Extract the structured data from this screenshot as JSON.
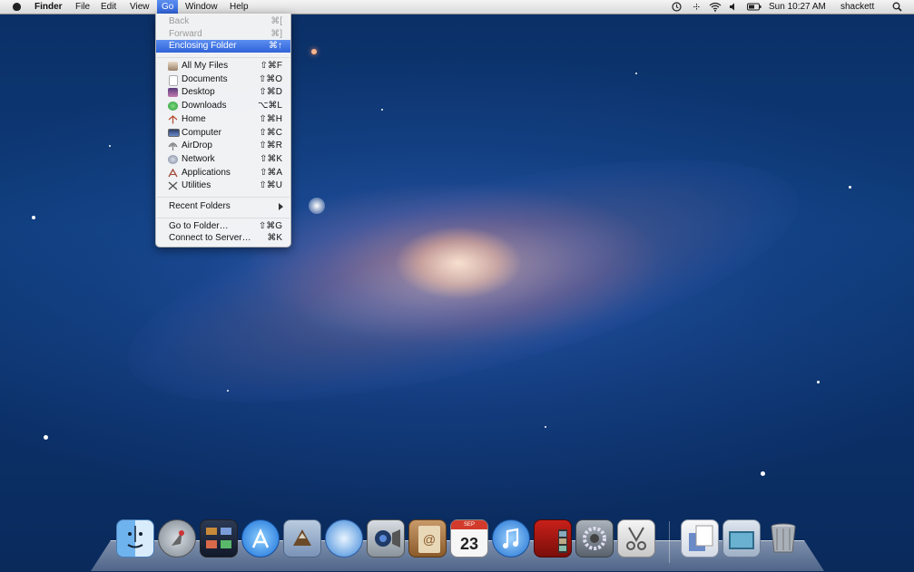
{
  "menubar": {
    "app_name": "Finder",
    "menus": [
      "File",
      "Edit",
      "View",
      "Go",
      "Window",
      "Help"
    ],
    "clock": "Sun 10:27 AM",
    "user": "shackett",
    "status_icons": [
      "time-machine-icon",
      "bluetooth-icon",
      "wifi-icon",
      "volume-icon",
      "battery-icon",
      "spotlight-icon"
    ]
  },
  "go_menu": {
    "items": [
      {
        "label": "Back",
        "shortcut": "⌘[",
        "state": "disabled"
      },
      {
        "label": "Forward",
        "shortcut": "⌘]",
        "state": "disabled"
      },
      {
        "label": "Enclosing Folder",
        "shortcut": "⌘↑",
        "state": "selected"
      },
      {
        "label": "All My Files",
        "shortcut": "⇧⌘F",
        "icon": "all-my-files-icon"
      },
      {
        "label": "Documents",
        "shortcut": "⇧⌘O",
        "icon": "documents-icon"
      },
      {
        "label": "Desktop",
        "shortcut": "⇧⌘D",
        "icon": "desktop-icon"
      },
      {
        "label": "Downloads",
        "shortcut": "⌥⌘L",
        "icon": "downloads-icon"
      },
      {
        "label": "Home",
        "shortcut": "⇧⌘H",
        "icon": "home-icon"
      },
      {
        "label": "Computer",
        "shortcut": "⇧⌘C",
        "icon": "computer-icon"
      },
      {
        "label": "AirDrop",
        "shortcut": "⇧⌘R",
        "icon": "airdrop-icon"
      },
      {
        "label": "Network",
        "shortcut": "⇧⌘K",
        "icon": "network-icon"
      },
      {
        "label": "Applications",
        "shortcut": "⇧⌘A",
        "icon": "applications-icon"
      },
      {
        "label": "Utilities",
        "shortcut": "⇧⌘U",
        "icon": "utilities-icon"
      },
      {
        "label": "Recent Folders",
        "shortcut": "",
        "submenu": true
      },
      {
        "label": "Go to Folder…",
        "shortcut": "⇧⌘G"
      },
      {
        "label": "Connect to Server…",
        "shortcut": "⌘K"
      }
    ]
  },
  "dock": {
    "items": [
      "finder-icon",
      "launchpad-icon",
      "mission-control-icon",
      "app-store-icon",
      "mail-icon",
      "safari-icon",
      "facetime-icon",
      "address-book-icon",
      "calendar-icon",
      "itunes-icon",
      "photo-booth-icon",
      "system-preferences-icon",
      "preview-icon",
      "documents-stack-icon",
      "downloads-stack-icon",
      "trash-icon"
    ],
    "calendar_day": "23",
    "calendar_month": "SEP"
  }
}
